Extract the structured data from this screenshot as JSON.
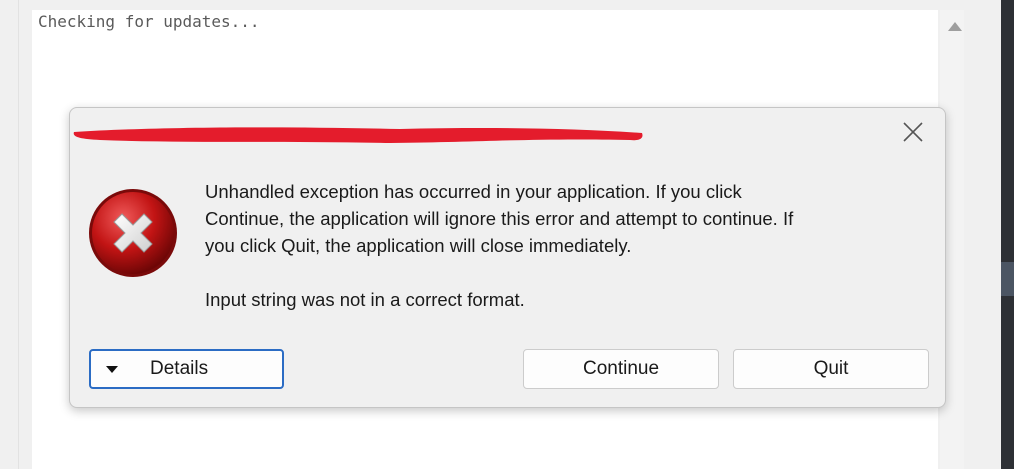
{
  "background": {
    "log_text": "Checking for updates..."
  },
  "dialog": {
    "title_redacted": true,
    "redaction_color": "#e41c2c",
    "icon": "error-icon",
    "message_line1": "Unhandled exception has occurred in your application. If you click",
    "message_line2": "Continue, the application will ignore this error and attempt to continue. If",
    "message_line3": "you click Quit, the application will close immediately.",
    "detail": "Input string was not in a correct format.",
    "buttons": {
      "details": "Details",
      "continue": "Continue",
      "quit": "Quit"
    },
    "accent_color": "#2b6cc4"
  }
}
